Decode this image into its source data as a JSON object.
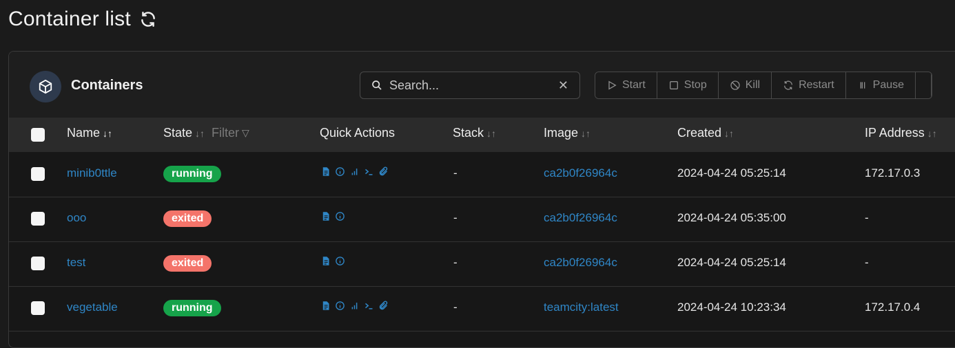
{
  "page": {
    "title": "Container list"
  },
  "panel": {
    "title": "Containers",
    "search_placeholder": "Search...",
    "actions": [
      {
        "label": "Start",
        "icon": "play-icon"
      },
      {
        "label": "Stop",
        "icon": "stop-icon"
      },
      {
        "label": "Kill",
        "icon": "ban-icon"
      },
      {
        "label": "Restart",
        "icon": "restart-icon"
      },
      {
        "label": "Pause",
        "icon": "pause-icon"
      }
    ]
  },
  "table": {
    "headers": {
      "name": "Name",
      "state": "State",
      "filter": "Filter",
      "quick_actions": "Quick Actions",
      "stack": "Stack",
      "image": "Image",
      "created": "Created",
      "ip": "IP Address"
    },
    "rows": [
      {
        "name": "minib0ttle",
        "state": "running",
        "stack": "-",
        "image": "ca2b0f26964c",
        "created": "2024-04-24 05:25:14",
        "ip": "172.17.0.3",
        "quick_actions": [
          "logs-icon",
          "inspect-icon",
          "stats-icon",
          "console-icon",
          "attach-icon"
        ]
      },
      {
        "name": "ooo",
        "state": "exited",
        "stack": "-",
        "image": "ca2b0f26964c",
        "created": "2024-04-24 05:35:00",
        "ip": "-",
        "quick_actions": [
          "logs-icon",
          "inspect-icon"
        ]
      },
      {
        "name": "test",
        "state": "exited",
        "stack": "-",
        "image": "ca2b0f26964c",
        "created": "2024-04-24 05:25:14",
        "ip": "-",
        "quick_actions": [
          "logs-icon",
          "inspect-icon"
        ]
      },
      {
        "name": "vegetable",
        "state": "running",
        "stack": "-",
        "image": "teamcity:latest",
        "created": "2024-04-24 10:23:34",
        "ip": "172.17.0.4",
        "quick_actions": [
          "logs-icon",
          "inspect-icon",
          "stats-icon",
          "console-icon",
          "attach-icon"
        ]
      }
    ]
  },
  "colors": {
    "link": "#2f86c6",
    "running": "#16a34a",
    "exited": "#f4746a"
  }
}
